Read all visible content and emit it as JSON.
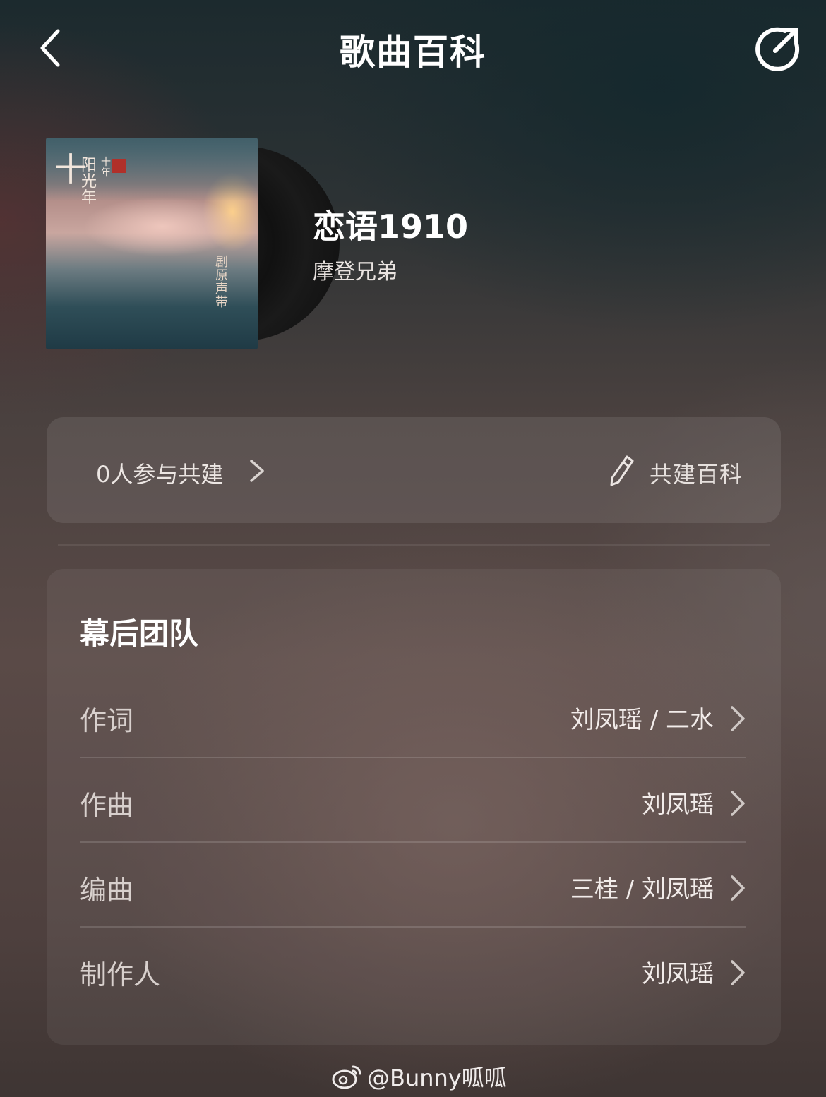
{
  "header": {
    "title": "歌曲百科"
  },
  "song": {
    "title": "恋语1910",
    "artist": "摩登兄弟"
  },
  "cover": {
    "text_main": "十",
    "text_side": "阳光年",
    "text_small": "十年",
    "text_right": "剧原声带"
  },
  "wiki": {
    "participants": "0人参与共建",
    "build_label": "共建百科"
  },
  "team": {
    "heading": "幕后团队",
    "rows": [
      {
        "label": "作词",
        "value": "刘凤瑶 / 二水"
      },
      {
        "label": "作曲",
        "value": "刘凤瑶"
      },
      {
        "label": "编曲",
        "value": "三桂 / 刘凤瑶"
      },
      {
        "label": "制作人",
        "value": "刘凤瑶"
      }
    ]
  },
  "watermark": {
    "text": "@Bunny呱呱"
  },
  "icons": [
    "back-arrow-icon",
    "share-icon",
    "chevron-right-icon",
    "pencil-icon",
    "weibo-icon"
  ]
}
